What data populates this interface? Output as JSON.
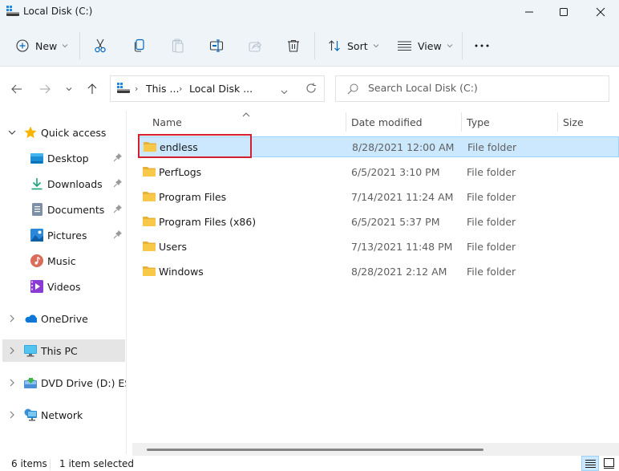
{
  "window": {
    "title": "Local Disk (C:)",
    "controls": {
      "minimize": "minimize",
      "maximize": "maximize",
      "close": "close"
    }
  },
  "toolbar": {
    "new_label": "New",
    "cut": "cut-icon",
    "copy": "copy-icon",
    "paste": "paste-icon",
    "rename": "rename-icon",
    "share": "share-icon",
    "delete": "delete-icon",
    "sort_label": "Sort",
    "view_label": "View",
    "more": "more-icon"
  },
  "nav": {
    "breadcrumb": [
      "This ...",
      "Local Disk ..."
    ],
    "search_placeholder": "Search Local Disk (C:)"
  },
  "sidebar": {
    "quick_access": {
      "label": "Quick access",
      "items": [
        {
          "label": "Desktop",
          "icon": "desktop-icon",
          "pinned": true
        },
        {
          "label": "Downloads",
          "icon": "downloads-icon",
          "pinned": true
        },
        {
          "label": "Documents",
          "icon": "documents-icon",
          "pinned": true
        },
        {
          "label": "Pictures",
          "icon": "pictures-icon",
          "pinned": true
        },
        {
          "label": "Music",
          "icon": "music-icon",
          "pinned": false
        },
        {
          "label": "Videos",
          "icon": "videos-icon",
          "pinned": false
        }
      ]
    },
    "roots": [
      {
        "label": "OneDrive",
        "icon": "onedrive-icon",
        "selected": false
      },
      {
        "label": "This PC",
        "icon": "this-pc-icon",
        "selected": true
      },
      {
        "label": "DVD Drive (D:) ESD-I",
        "icon": "dvd-drive-icon",
        "selected": false
      },
      {
        "label": "Network",
        "icon": "network-icon",
        "selected": false
      }
    ]
  },
  "table": {
    "columns": [
      "Name",
      "Date modified",
      "Type",
      "Size"
    ],
    "rows": [
      {
        "name": "endless",
        "date": "8/28/2021 12:00 AM",
        "type": "File folder",
        "size": "",
        "selected": true
      },
      {
        "name": "PerfLogs",
        "date": "6/5/2021 3:10 PM",
        "type": "File folder",
        "size": "",
        "selected": false
      },
      {
        "name": "Program Files",
        "date": "7/14/2021 11:24 AM",
        "type": "File folder",
        "size": "",
        "selected": false
      },
      {
        "name": "Program Files (x86)",
        "date": "6/5/2021 5:37 PM",
        "type": "File folder",
        "size": "",
        "selected": false
      },
      {
        "name": "Users",
        "date": "7/13/2021 11:48 PM",
        "type": "File folder",
        "size": "",
        "selected": false
      },
      {
        "name": "Windows",
        "date": "8/28/2021 2:12 AM",
        "type": "File folder",
        "size": "",
        "selected": false
      }
    ]
  },
  "status": {
    "item_count": "6 items",
    "selection": "1 item selected"
  },
  "colors": {
    "accent": "#0067c0",
    "selection_bg": "#cce8ff",
    "selection_border": "#99d1ff",
    "highlight_box": "#d32030",
    "folder": "#f8c948"
  }
}
